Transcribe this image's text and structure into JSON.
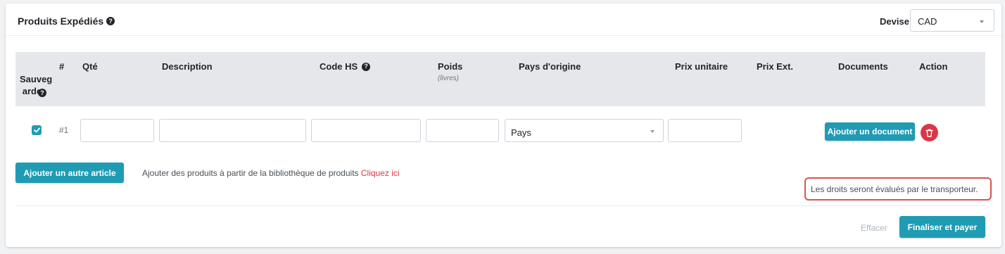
{
  "header": {
    "title": "Produits Expédiés",
    "currency_label": "Devise",
    "currency_value": "CAD"
  },
  "table": {
    "columns": {
      "save": "Sauveg\narder",
      "number": "#",
      "qty": "Qté",
      "description": "Description",
      "hs_code": "Code HS",
      "weight": "Poids",
      "weight_unit": "(livres)",
      "origin": "Pays d'origine",
      "unit_price": "Prix unitaire",
      "ext_price": "Prix Ext.",
      "documents": "Documents",
      "action": "Action"
    },
    "rows": [
      {
        "number": "#1",
        "saved": true,
        "qty": "",
        "description": "",
        "hs_code": "",
        "weight": "",
        "origin_placeholder": "Pays",
        "unit_price": "",
        "ext_price": "",
        "add_document_label": "Ajouter un document"
      }
    ]
  },
  "actions": {
    "add_article_label": "Ajouter un autre article",
    "library_text": "Ajouter des produits à partir de la bibliothèque de produits",
    "library_link": "Cliquez ici",
    "duties_note": "Les droits seront évalués par le transporteur.",
    "clear_label": "Effacer",
    "finalize_label": "Finaliser et payer"
  },
  "icons": {
    "help": "question-circle-icon",
    "check": "check-icon",
    "delete": "trash-icon",
    "dropdown": "caret-down-icon"
  },
  "colors": {
    "accent": "#1f9bb3",
    "danger": "#dc3545",
    "highlight_border": "#d9534f",
    "table_header_bg": "#e6e7ea"
  }
}
